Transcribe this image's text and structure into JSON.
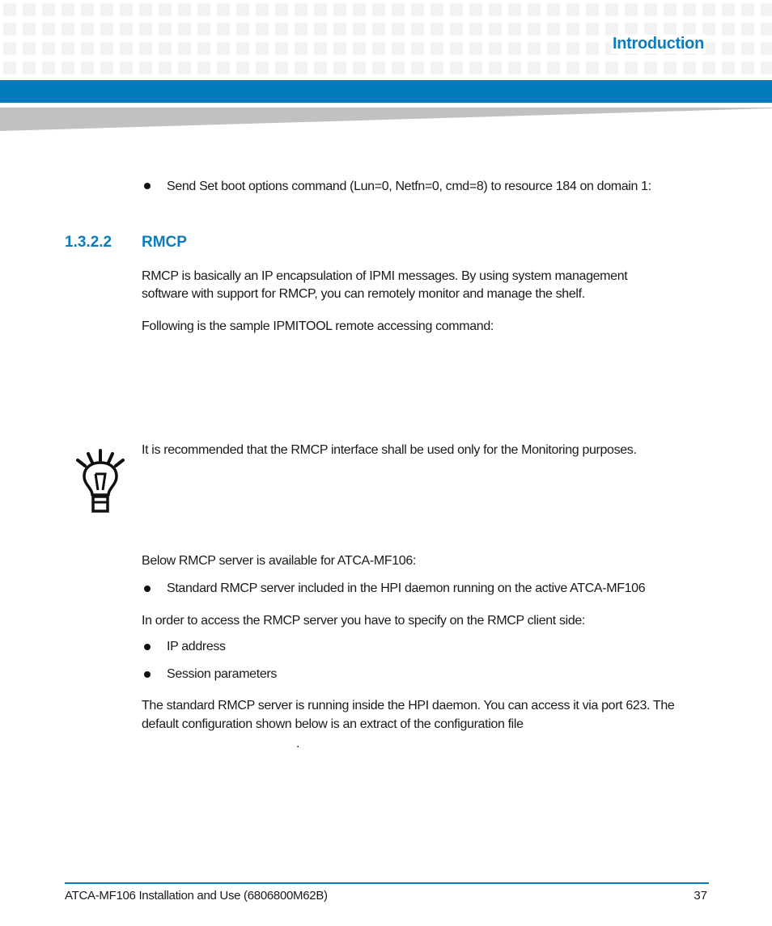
{
  "header": {
    "section_title": "Introduction",
    "accent_color": "#027cbd",
    "heading_color": "#0a7dbe"
  },
  "content": {
    "bullet_boot": "Send Set boot options command (Lun=0, Netfn=0, cmd=8) to resource 184 on domain 1:",
    "heading": {
      "number": "1.3.2.2",
      "title": "RMCP"
    },
    "para1_line1": "RMCP is basically an IP encapsulation of IPMI messages. By using system management",
    "para1_line2": "software with support for RMCP, you can remotely monitor and manage the shelf.",
    "para2": "Following is the sample IPMITOOL remote accessing command:",
    "note": {
      "icon": "lightbulb-icon",
      "text": "It is recommended that the RMCP interface shall be used only for the Monitoring purposes."
    },
    "para3": "Below RMCP server is available for ATCA-MF106:",
    "bullet_server": "Standard RMCP server included in the HPI daemon running on the active ATCA-MF106",
    "para4": "In order to access the RMCP server you have to specify on the RMCP client side:",
    "client_bullets": [
      "IP address",
      "Session parameters"
    ],
    "para5_line1": "The standard RMCP server is running inside the HPI daemon. You can access it via port 623. The",
    "para5_line2": "default configuration shown below is an extract of the configuration file",
    "para5_line3": "."
  },
  "footer": {
    "document_title": "ATCA-MF106 Installation and Use (6806800M62B)",
    "page_number": "37"
  }
}
